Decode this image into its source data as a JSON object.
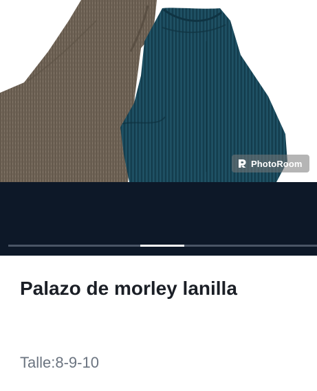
{
  "gallery": {
    "watermark_text": "PhotoRoom",
    "watermark_icon": "photoroom-logo-icon",
    "current_page": 4,
    "total_pages": 7
  },
  "product": {
    "title": "Palazo de morley lanilla",
    "size_text": "Talle:8-9-10"
  },
  "colors": {
    "gallery_background": "#0d1828",
    "title": "#1b1f26",
    "subtitle": "#6b7480",
    "pager_active": "#ffffff",
    "pager_track": "#4a5566"
  }
}
